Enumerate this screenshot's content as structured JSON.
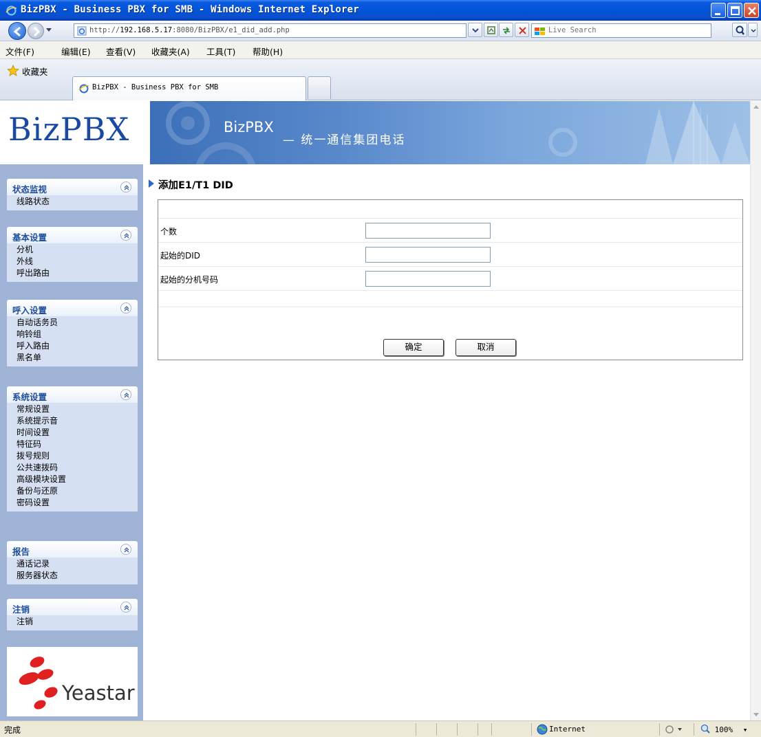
{
  "window": {
    "title": "BizPBX - Business PBX for SMB - Windows Internet Explorer"
  },
  "address_bar": {
    "url_prefix": "http://",
    "url_host": "192.168.5.17",
    "url_rest": ":8080/BizPBX/e1_did_add.php",
    "search_placeholder": "Live Search"
  },
  "menu": {
    "items": [
      "文件(F)",
      "编辑(E)",
      "查看(V)",
      "收藏夹(A)",
      "工具(T)",
      "帮助(H)"
    ]
  },
  "favorites": {
    "label": "收藏夹"
  },
  "tab": {
    "label": "BizPBX - Business PBX for SMB"
  },
  "logo": {
    "text": "BizPBX"
  },
  "banner": {
    "title": "BizPBX",
    "subtitle": "— 统一通信集团电话"
  },
  "sidebar": {
    "groups": [
      {
        "title": "状态监视",
        "items": [
          "线路状态"
        ]
      },
      {
        "title": "基本设置",
        "items": [
          "分机",
          "外线",
          "呼出路由"
        ]
      },
      {
        "title": "呼入设置",
        "items": [
          "自动话务员",
          "响铃组",
          "呼入路由",
          "黑名单"
        ]
      },
      {
        "title": "系统设置",
        "items": [
          "常规设置",
          "系统提示音",
          "时间设置",
          "特征码",
          "拨号规则",
          "公共速拨码",
          "高级模块设置",
          "备份与还原",
          "密码设置"
        ]
      },
      {
        "title": "报告",
        "items": [
          "通话记录",
          "服务器状态"
        ]
      },
      {
        "title": "注销",
        "items": [
          "注销"
        ]
      }
    ],
    "brand": "Yeastar"
  },
  "page": {
    "heading": "添加E1/T1 DID",
    "fields": [
      {
        "label": "个数",
        "value": ""
      },
      {
        "label": "起始的DID",
        "value": ""
      },
      {
        "label": "起始的分机号码",
        "value": ""
      }
    ],
    "confirm_label": "确定",
    "cancel_label": "取消"
  },
  "status_bar": {
    "status": "完成",
    "zone": "Internet",
    "zoom": "100%"
  },
  "colors": {
    "title_bar": "#0254d8",
    "sidebar_bg": "#9fb3d6",
    "group_title": "#1f4e9c",
    "logo_blue": "#1a4aa0",
    "yeastar_red": "#e02020"
  }
}
